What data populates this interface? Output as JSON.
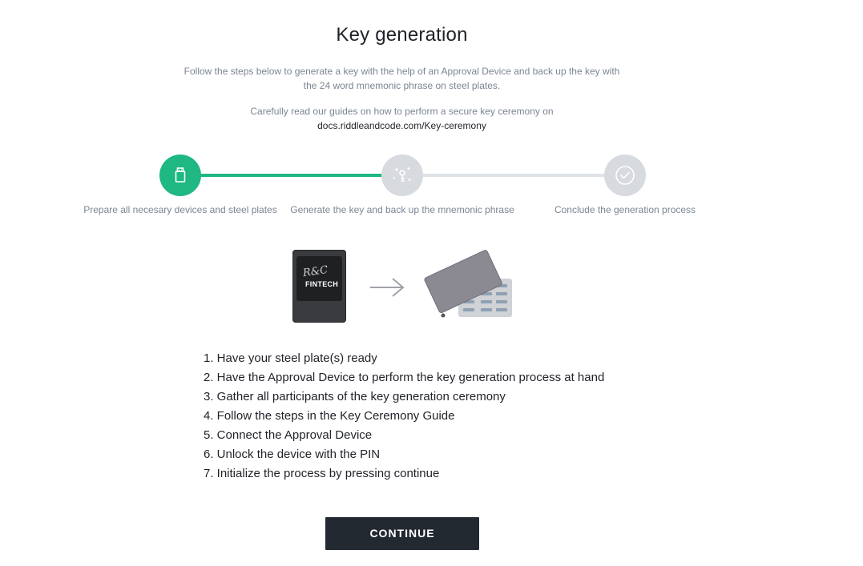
{
  "page": {
    "title": "Key generation",
    "intro": [
      "Follow the steps below to generate a key with the help of an Approval Device and back up the key with",
      "the 24 word mnemonic phrase on steel plates."
    ],
    "guide_text": "Carefully read our guides on how to perform a secure key ceremony on",
    "guide_link": "docs.riddleandcode.com/Key-ceremony"
  },
  "stepper": {
    "steps": [
      {
        "label": "Prepare all necesary devices and steel plates",
        "icon": "usb-icon",
        "status": "active"
      },
      {
        "label": "Generate the key and back up the mnemonic phrase",
        "icon": "key-sparkle-icon",
        "status": "pending"
      },
      {
        "label": "Conclude the generation process",
        "icon": "check-circle-icon",
        "status": "pending"
      }
    ],
    "colors": {
      "active": "#1fb882",
      "pending": "#d7dade"
    }
  },
  "illustration": {
    "device_brand_script": "R&C",
    "device_brand": "FINTECH"
  },
  "instructions": [
    "1. Have your steel plate(s) ready",
    "2. Have the Approval Device to perform the key generation process at hand",
    "3. Gather all participants of the key generation ceremony",
    "4. Follow the steps in the Key Ceremony Guide",
    "5. Connect the Approval Device",
    "6. Unlock the device with the PIN",
    "7. Initialize the process by pressing continue"
  ],
  "actions": {
    "continue_label": "CONTINUE"
  }
}
